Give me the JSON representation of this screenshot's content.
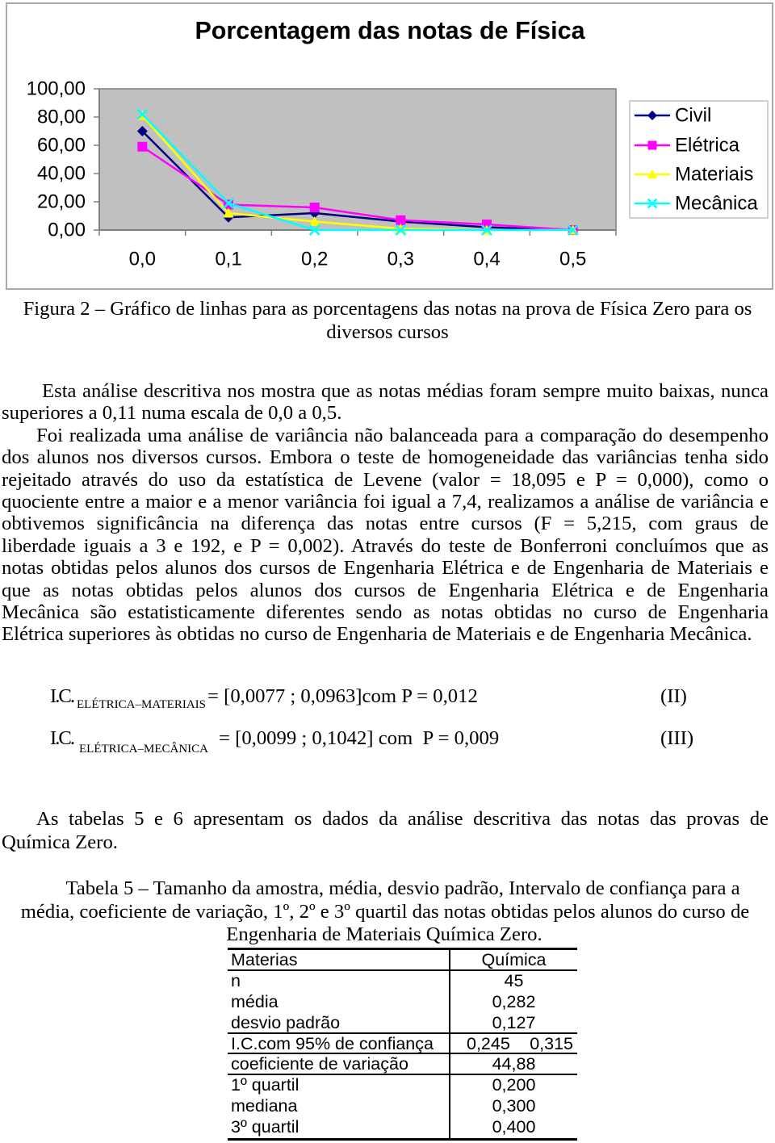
{
  "chart_data": {
    "type": "line",
    "title": "Porcentagem das notas de Física",
    "xlabel": "",
    "ylabel": "",
    "categories": [
      "0,0",
      "0,1",
      "0,2",
      "0,3",
      "0,4",
      "0,5"
    ],
    "y_tick_labels": [
      "100,00",
      "80,00",
      "60,00",
      "40,00",
      "20,00",
      "0,00"
    ],
    "ylim": [
      0,
      100
    ],
    "grid": false,
    "plot_background": "#c0c0c0",
    "legend_position": "right",
    "series": [
      {
        "name": "Civil",
        "marker": "diamond",
        "color": "#000080",
        "values": [
          70,
          9,
          12,
          6,
          2,
          0
        ]
      },
      {
        "name": "Elétrica",
        "marker": "square",
        "color": "#ff00ff",
        "values": [
          59,
          18,
          16,
          7,
          4,
          0
        ]
      },
      {
        "name": "Materiais",
        "marker": "triangle",
        "color": "#ffff00",
        "values": [
          81,
          12,
          6,
          1,
          0,
          0
        ]
      },
      {
        "name": "Mecânica",
        "marker": "x",
        "color": "#00ffff",
        "values": [
          82,
          19,
          0,
          0,
          0,
          0
        ]
      }
    ]
  },
  "figure_caption": [
    "Figura 2 – Gráfico de linhas para as porcentagens das notas na prova de Física Zero para os",
    "diversos cursos"
  ],
  "body": {
    "paragraphs": [
      {
        "lines": [
          "Esta análise descritiva nos mostra que as notas médias foram sempre muito baixas, nunca",
          "superiores a 0,11 numa escala de 0,0 a 0,5."
        ]
      },
      {
        "lines": [
          "Foi realizada uma análise de variância não balanceada para a comparação do desempenho",
          "dos alunos nos diversos cursos. Embora o teste de homogeneidade das variâncias tenha sido",
          "rejeitado através do uso da estatística de Levene (valor = 18,095 e P = 0,000), como o",
          "quociente entre a maior e a menor variância foi igual a 7,4, realizamos a análise de variância e",
          "obtivemos significância na diferença das notas entre cursos (F = 5,215, com graus de",
          "liberdade iguais a 3 e 192, e P = 0,002).  Através do teste de Bonferroni concluímos que as",
          "notas obtidas pelos alunos dos cursos de Engenharia Elétrica e de Engenharia de Materiais e",
          "que as notas obtidas pelos alunos dos cursos de Engenharia Elétrica e de Engenharia",
          "Mecânica são estatisticamente diferentes sendo as notas obtidas no curso de Engenharia",
          "Elétrica superiores às obtidas no curso de Engenharia de Materiais e de Engenharia Mecânica."
        ]
      }
    ]
  },
  "equations": [
    {
      "term": "I.C.",
      "subscript": "ELÉTRICA–MATERIAIS",
      "expression": "= [0,0077 ; 0,0963]com P = 0,012",
      "label": "(II)"
    },
    {
      "term": "I.C.",
      "subscript": "ELÉTRICA–MECÂNICA",
      "expression": "= [0,0099 ; 0,1042] com  P = 0,009",
      "label": "(III)"
    }
  ],
  "tables_paragraph": {
    "lines": [
      "As tabelas 5 e 6 apresentam os dados da análise descritiva das notas das provas de",
      "Química Zero."
    ]
  },
  "table5": {
    "caption": [
      "Tabela 5 – Tamanho da amostra, média, desvio padrão, Intervalo de confiança para a",
      "média, coeficiente de variação, 1º, 2º e 3º quartil das notas obtidas pelos alunos do curso de",
      "Engenharia de Materiais Química Zero."
    ],
    "header": [
      "Materias",
      "Química"
    ],
    "rows": [
      {
        "label": "n",
        "values": [
          "45"
        ]
      },
      {
        "label": "média",
        "values": [
          "0,282"
        ]
      },
      {
        "label": "desvio padrão",
        "values": [
          "0,127"
        ]
      },
      {
        "label": "I.C.com 95% de confiança",
        "values": [
          "0,245",
          "0,315"
        ]
      },
      {
        "label": "coeficiente de variação",
        "values": [
          "44,88"
        ]
      },
      {
        "label": "1º quartil",
        "values": [
          "0,200"
        ]
      },
      {
        "label": "mediana",
        "values": [
          "0,300"
        ]
      },
      {
        "label": "3º quartil",
        "values": [
          "0,400"
        ]
      }
    ]
  }
}
